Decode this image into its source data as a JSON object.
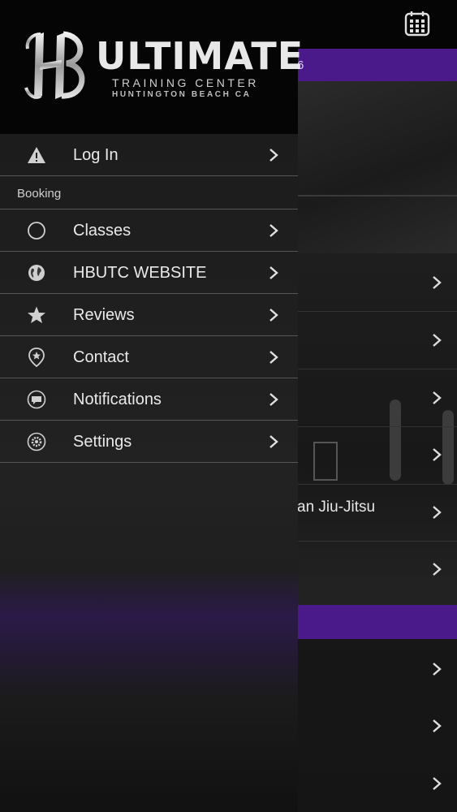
{
  "app": {
    "logo_title": "ULTIMATE",
    "logo_subtitle": "TRAINING CENTER",
    "logo_location": "HUNTINGTON BEACH CA"
  },
  "background": {
    "purple_bar_text": "6",
    "row_text": "an Jiu-Jitsu"
  },
  "menu": {
    "login": {
      "label": "Log In",
      "icon": "warning-icon"
    },
    "section_booking": "Booking",
    "items": [
      {
        "label": "Classes",
        "icon": "circle-icon"
      },
      {
        "label": "HBUTC WEBSITE",
        "icon": "globe-icon"
      },
      {
        "label": "Reviews",
        "icon": "star-icon"
      },
      {
        "label": "Contact",
        "icon": "location-pin-icon"
      },
      {
        "label": "Notifications",
        "icon": "chat-bubble-icon"
      },
      {
        "label": "Settings",
        "icon": "gear-icon"
      }
    ]
  },
  "colors": {
    "accent_purple": "#4b1a8a",
    "drawer_bg": "#222222",
    "header_bg": "#050505",
    "divider": "#555555"
  }
}
